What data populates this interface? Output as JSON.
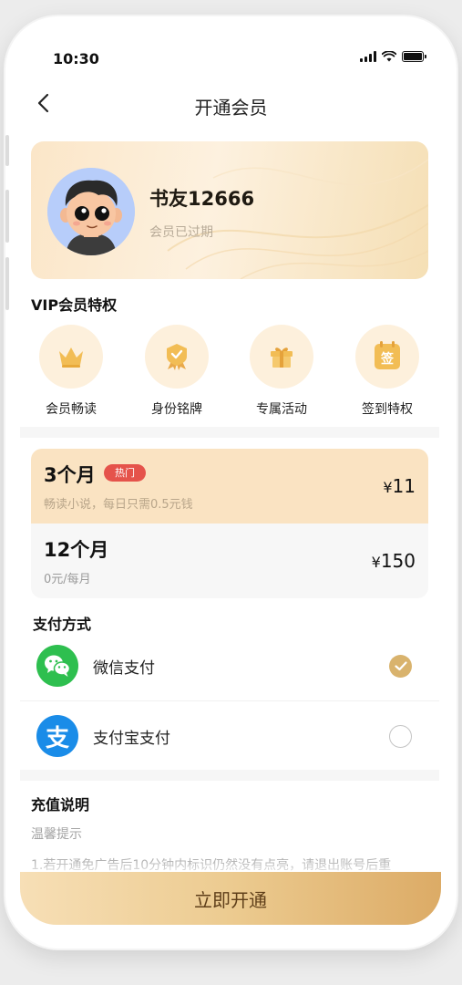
{
  "status_bar": {
    "time": "10:30"
  },
  "nav": {
    "title": "开通会员"
  },
  "member": {
    "name": "书友12666",
    "status": "会员已过期"
  },
  "vip_section": {
    "title": "VIP会员特权",
    "perks": [
      {
        "label": "会员畅读",
        "icon": "crown-icon"
      },
      {
        "label": "身份铭牌",
        "icon": "badge-icon"
      },
      {
        "label": "专属活动",
        "icon": "gift-icon"
      },
      {
        "label": "签到特权",
        "icon": "calendar-sign-icon",
        "icon_text": "签"
      }
    ]
  },
  "plans": [
    {
      "name": "3个月",
      "badge": "热门",
      "desc": "畅读小说，每日只需0.5元钱",
      "currency": "¥",
      "price": "11",
      "selected": true
    },
    {
      "name": "12个月",
      "badge": "",
      "desc": "0元/每月",
      "currency": "¥",
      "price": "150",
      "selected": false
    }
  ],
  "payment": {
    "title": "支付方式",
    "methods": [
      {
        "label": "微信支付",
        "icon": "wechat-icon",
        "color": "#2ebf4f",
        "selected": true
      },
      {
        "label": "支付宝支付",
        "icon": "alipay-icon",
        "icon_text": "支",
        "color": "#1a8ce8",
        "selected": false
      }
    ]
  },
  "notes": {
    "title": "充值说明",
    "subtitle": "温馨提示",
    "line1": "1.若开通免广告后10分钟内标识仍然没有点亮，请退出账号后重"
  },
  "cta": {
    "label": "立即开通"
  },
  "colors": {
    "gold": "#d9b36d",
    "hot_badge": "#e5534b",
    "card_bg": "#fbe6c8"
  }
}
